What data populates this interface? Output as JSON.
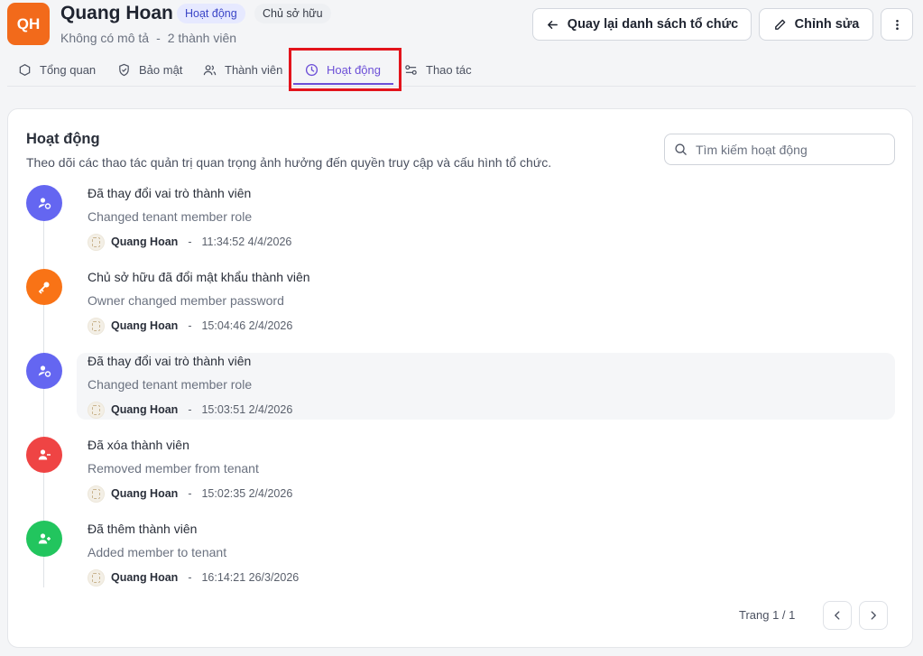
{
  "org": {
    "initials": "QH",
    "name": "Quang Hoan",
    "status_badge": "Hoạt động",
    "role_badge": "Chủ sở hữu",
    "description": "Không có mô tả",
    "separator": "-",
    "member_count": "2 thành viên"
  },
  "actions": {
    "back_label": "Quay lại danh sách tổ chức",
    "edit_label": "Chỉnh sửa"
  },
  "tabs": [
    {
      "label": "Tổng quan",
      "icon": "circle-icon"
    },
    {
      "label": "Bảo mật",
      "icon": "shield-icon"
    },
    {
      "label": "Thành viên",
      "icon": "users-icon"
    },
    {
      "label": "Hoạt động",
      "icon": "clock-icon",
      "active": true
    },
    {
      "label": "Thao tác",
      "icon": "sliders-icon"
    }
  ],
  "activity": {
    "title": "Hoạt động",
    "description": "Theo dõi các thao tác quản trị quan trọng ảnh hưởng đến quyền truy cập và cấu hình tổ chức.",
    "search_placeholder": "Tìm kiếm hoạt động",
    "events": [
      {
        "title": "Đã thay đổi vai trò thành viên",
        "subtitle": "Changed tenant member role",
        "user": "Quang Hoan",
        "time": "11:34:52 4/4/2026",
        "icon": "user-role-icon",
        "color": "#6466f1"
      },
      {
        "title": "Chủ sở hữu đã đổi mật khẩu thành viên",
        "subtitle": "Owner changed member password",
        "user": "Quang Hoan",
        "time": "15:04:46 2/4/2026",
        "icon": "key-icon",
        "color": "#f97316"
      },
      {
        "title": "Đã thay đổi vai trò thành viên",
        "subtitle": "Changed tenant member role",
        "user": "Quang Hoan",
        "time": "15:03:51 2/4/2026",
        "icon": "user-role-icon",
        "color": "#6466f1"
      },
      {
        "title": "Đã xóa thành viên",
        "subtitle": "Removed member from tenant",
        "user": "Quang Hoan",
        "time": "15:02:35 2/4/2026",
        "icon": "user-minus-icon",
        "color": "#ef4444"
      },
      {
        "title": "Đã thêm thành viên",
        "subtitle": "Added member to tenant",
        "user": "Quang Hoan",
        "time": "16:14:21 26/3/2026",
        "icon": "user-plus-icon",
        "color": "#22c55e"
      }
    ],
    "time_separator": "-",
    "pagination": "Trang 1 / 1"
  }
}
